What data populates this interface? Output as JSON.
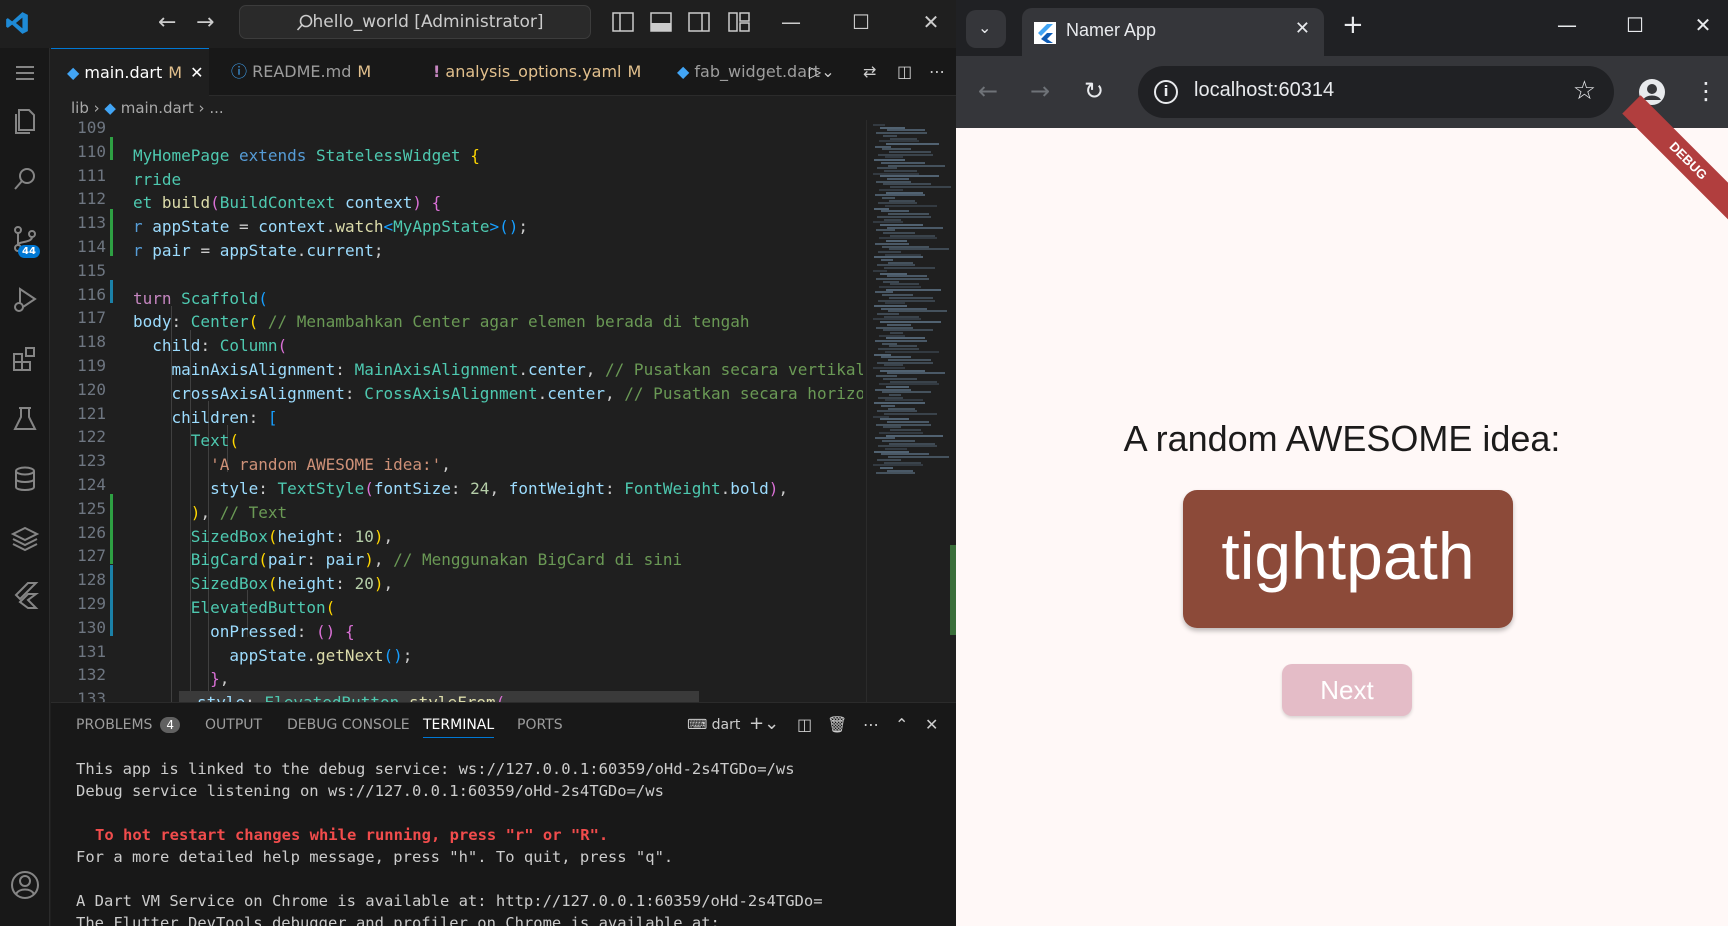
{
  "vscode": {
    "search_title": "hello_world [Administrator]",
    "tabs": [
      {
        "label": "main.dart",
        "mod": "M",
        "active": true
      },
      {
        "label": "README.md",
        "mod": "M"
      },
      {
        "label": "analysis_options.yaml",
        "mod": "M"
      },
      {
        "label": "fab_widget.dart"
      }
    ],
    "breadcrumb": {
      "folder": "lib",
      "file": "main.dart",
      "rest": "..."
    },
    "source_control_badge": "44",
    "line_numbers": [
      "109",
      "110",
      "111",
      "112",
      "113",
      "114",
      "115",
      "116",
      "117",
      "118",
      "119",
      "120",
      "121",
      "122",
      "123",
      "124",
      "125",
      "126",
      "127",
      "128",
      "129",
      "130",
      "131",
      "132",
      "133"
    ],
    "panel": {
      "tabs": [
        "PROBLEMS",
        "OUTPUT",
        "DEBUG CONSOLE",
        "TERMINAL",
        "PORTS"
      ],
      "problems_count": "4",
      "shell": "dart"
    },
    "terminal_lines": [
      "This app is linked to the debug service: ws://127.0.0.1:60359/oHd-2s4TGDo=/ws",
      "Debug service listening on ws://127.0.0.1:60359/oHd-2s4TGDo=/ws",
      "To hot restart changes while running, press \"r\" or \"R\".",
      "For a more detailed help message, press \"h\". To quit, press \"q\".",
      "A Dart VM Service on Chrome is available at: http://127.0.0.1:60359/oHd-2s4TGDo=",
      "The Flutter DevTools debugger and profiler on Chrome is available at:"
    ]
  },
  "chrome": {
    "tab_title": "Namer App",
    "url": "localhost:60314",
    "debug_label": "DEBUG"
  },
  "app": {
    "title": "A random AWESOME idea:",
    "word": "tightpath",
    "next_label": "Next",
    "colors": {
      "card": "#8c4a39",
      "button": "#e4bcc7",
      "background": "#fff8f7"
    }
  }
}
